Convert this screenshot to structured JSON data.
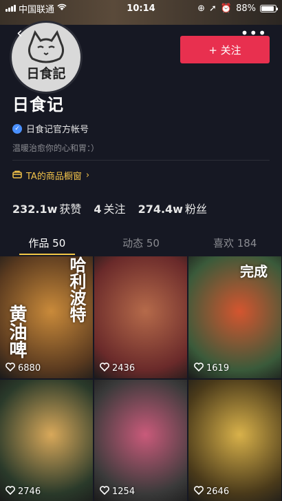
{
  "status_bar": {
    "carrier": "中国联通",
    "time": "10:14",
    "battery": "88%",
    "battery_level": 0.88
  },
  "profile": {
    "name": "日食记",
    "avatar_text": "日食記",
    "verified_label": "日食记官方帐号",
    "bio": "温暖治愈你的心和胃：）",
    "shop_label": "TA的商品橱窗",
    "follow_label": "+ 关注"
  },
  "stats": [
    {
      "value": "232.1w",
      "label": "获赞"
    },
    {
      "value": "4",
      "label": "关注"
    },
    {
      "value": "274.4w",
      "label": "粉丝"
    }
  ],
  "tabs": [
    {
      "label": "作品 50",
      "active": true
    },
    {
      "label": "动态 50",
      "active": false
    },
    {
      "label": "喜欢 184",
      "active": false
    }
  ],
  "videos": [
    {
      "likes": "6880",
      "overlay": "黄油啤",
      "overlay2": "哈利波特",
      "color1": "#5a3a1f",
      "color2": "#c98a3a"
    },
    {
      "likes": "2436",
      "overlay": "",
      "overlay2": "",
      "color1": "#6a2a2a",
      "color2": "#b56a4a"
    },
    {
      "likes": "1619",
      "overlay": "完成",
      "overlay2": "",
      "color1": "#3a5a3a",
      "color2": "#d4552f"
    },
    {
      "likes": "2746",
      "overlay": "",
      "overlay2": "",
      "color1": "#2a3a2a",
      "color2": "#d8a85a"
    },
    {
      "likes": "1254",
      "overlay": "",
      "overlay2": "",
      "color1": "#3a3a3a",
      "color2": "#c95a7a"
    },
    {
      "likes": "2646",
      "overlay": "",
      "overlay2": "",
      "color1": "#4a3a1a",
      "color2": "#d8b14a"
    }
  ],
  "colors": {
    "background": "#161823",
    "accent": "#e8304f",
    "tab_indicator": "#f3c846",
    "shop": "#f1c24a"
  }
}
